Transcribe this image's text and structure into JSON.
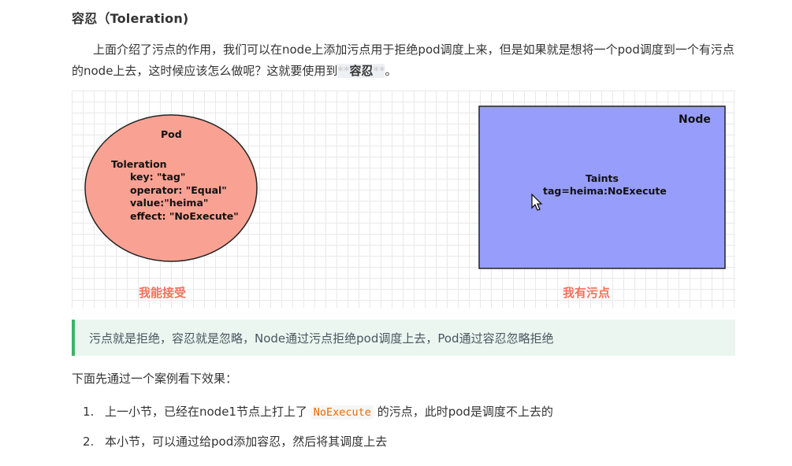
{
  "heading": "容忍（Toleration)",
  "intro": {
    "text_before": "上面介绍了污点的作用，我们可以在node上添加污点用于拒绝pod调度上来，但是如果就是想将一个pod调度到一个有污点的node上去，这时候应该怎么做呢？这就要使用到",
    "mark_open": "**",
    "strong": "容忍",
    "mark_close": "**",
    "text_after": "。"
  },
  "figure": {
    "pod": {
      "title": "Pod",
      "toleration_label": "Toleration",
      "key_line": "key: \"tag\"",
      "operator_line": "operator: \"Equal\"",
      "value_line": "value:\"heima\"",
      "effect_line": "effect: \"NoExecute\"",
      "caption": "我能接受",
      "fill_color": "#f9a293"
    },
    "node": {
      "title": "Node",
      "taints_label": "Taints",
      "taint_line": "tag=heima:NoExecute",
      "caption": "我有污点",
      "fill_color": "#979dfb"
    },
    "caption_color": "#f4715c"
  },
  "note": {
    "text": "污点就是拒绝，容忍就是忽略，Node通过污点拒绝pod调度上去，Pod通过容忍忽略拒绝",
    "accent_color": "#3eb26a"
  },
  "lead": "下面先通过一个案例看下效果：",
  "list": [
    {
      "num": "1.",
      "before": "上一小节，已经在node1节点上打上了",
      "code": "NoExecute",
      "after": "的污点，此时pod是调度不上去的"
    },
    {
      "num": "2.",
      "text": "本小节，可以通过给pod添加容忍，然后将其调度上去"
    }
  ]
}
